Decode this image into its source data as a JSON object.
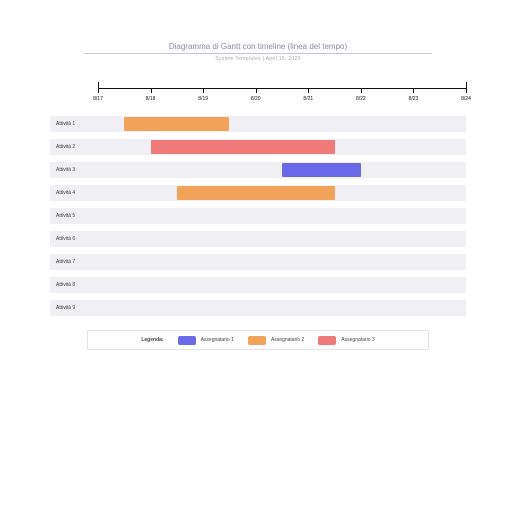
{
  "header": {
    "title": "Diagramma di Gantt con timeline (linea del tempo)",
    "subtitle": "System Templates  |  April 15, 2020"
  },
  "chart_data": {
    "type": "bar",
    "orientation": "gantt",
    "x_axis": {
      "ticks": [
        "8/17",
        "8/18",
        "8/19",
        "8/20",
        "8/21",
        "8/22",
        "8/23",
        "8/24"
      ],
      "range": [
        0,
        7
      ]
    },
    "rows": [
      {
        "label": "Attività 1",
        "bars": [
          {
            "start": 0.5,
            "end": 2.5,
            "assignee": 2
          }
        ]
      },
      {
        "label": "Attività 2",
        "bars": [
          {
            "start": 1.0,
            "end": 4.5,
            "assignee": 3
          }
        ]
      },
      {
        "label": "Attività 3",
        "bars": [
          {
            "start": 3.5,
            "end": 5.0,
            "assignee": 1
          }
        ]
      },
      {
        "label": "Attività 4",
        "bars": [
          {
            "start": 1.5,
            "end": 4.5,
            "assignee": 2
          }
        ]
      },
      {
        "label": "Attività 5",
        "bars": []
      },
      {
        "label": "Attività 6",
        "bars": []
      },
      {
        "label": "Attività 7",
        "bars": []
      },
      {
        "label": "Attività 8",
        "bars": []
      },
      {
        "label": "Attività 9",
        "bars": []
      }
    ],
    "assignees": {
      "1": {
        "name": "Assegnatario 1",
        "color": "#6a6ae8"
      },
      "2": {
        "name": "Assegnatario 2",
        "color": "#f2a35a"
      },
      "3": {
        "name": "Assegnatario 3",
        "color": "#f07a7a"
      }
    }
  },
  "legend": {
    "label": "Legenda:",
    "items": [
      {
        "swatch": "c-blue",
        "text": "Assegnatario 1"
      },
      {
        "swatch": "c-orange",
        "text": "Assegnatario 2"
      },
      {
        "swatch": "c-red",
        "text": "Assegnatario 3"
      }
    ]
  }
}
